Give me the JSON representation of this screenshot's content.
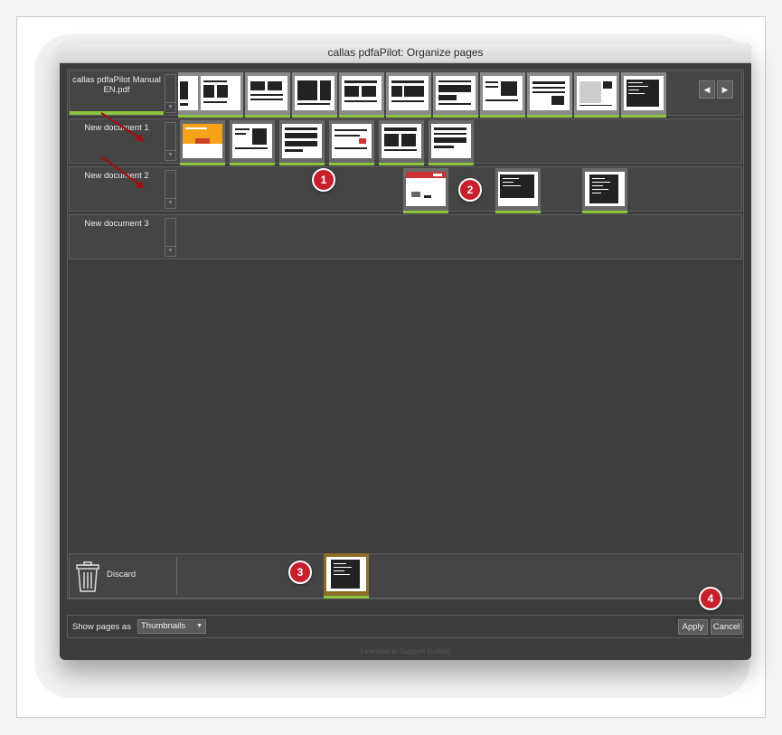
{
  "window": {
    "title": "callas pdfaPilot: Organize pages"
  },
  "rows": [
    {
      "label": "callas pdfaPilot Manual EN.pdf"
    },
    {
      "label": "New document 1"
    },
    {
      "label": "New document 2"
    },
    {
      "label": "New document 3"
    }
  ],
  "discard": {
    "label": "Discard"
  },
  "bottom": {
    "show_label": "Show pages as",
    "view_selected": "Thumbnails",
    "apply_label": "Apply",
    "cancel_label": "Cancel"
  },
  "footer": {
    "license": "Licensed to Support (callas)"
  },
  "badges": [
    "1",
    "2",
    "3",
    "4"
  ],
  "icons": {
    "nav_left": "chevron-left-icon",
    "nav_right": "chevron-right-icon",
    "trash": "trash-icon"
  },
  "colors": {
    "accent_green": "#8cc63f",
    "badge_red": "#c7202c",
    "selected_thumb": "#8c6f2a"
  }
}
